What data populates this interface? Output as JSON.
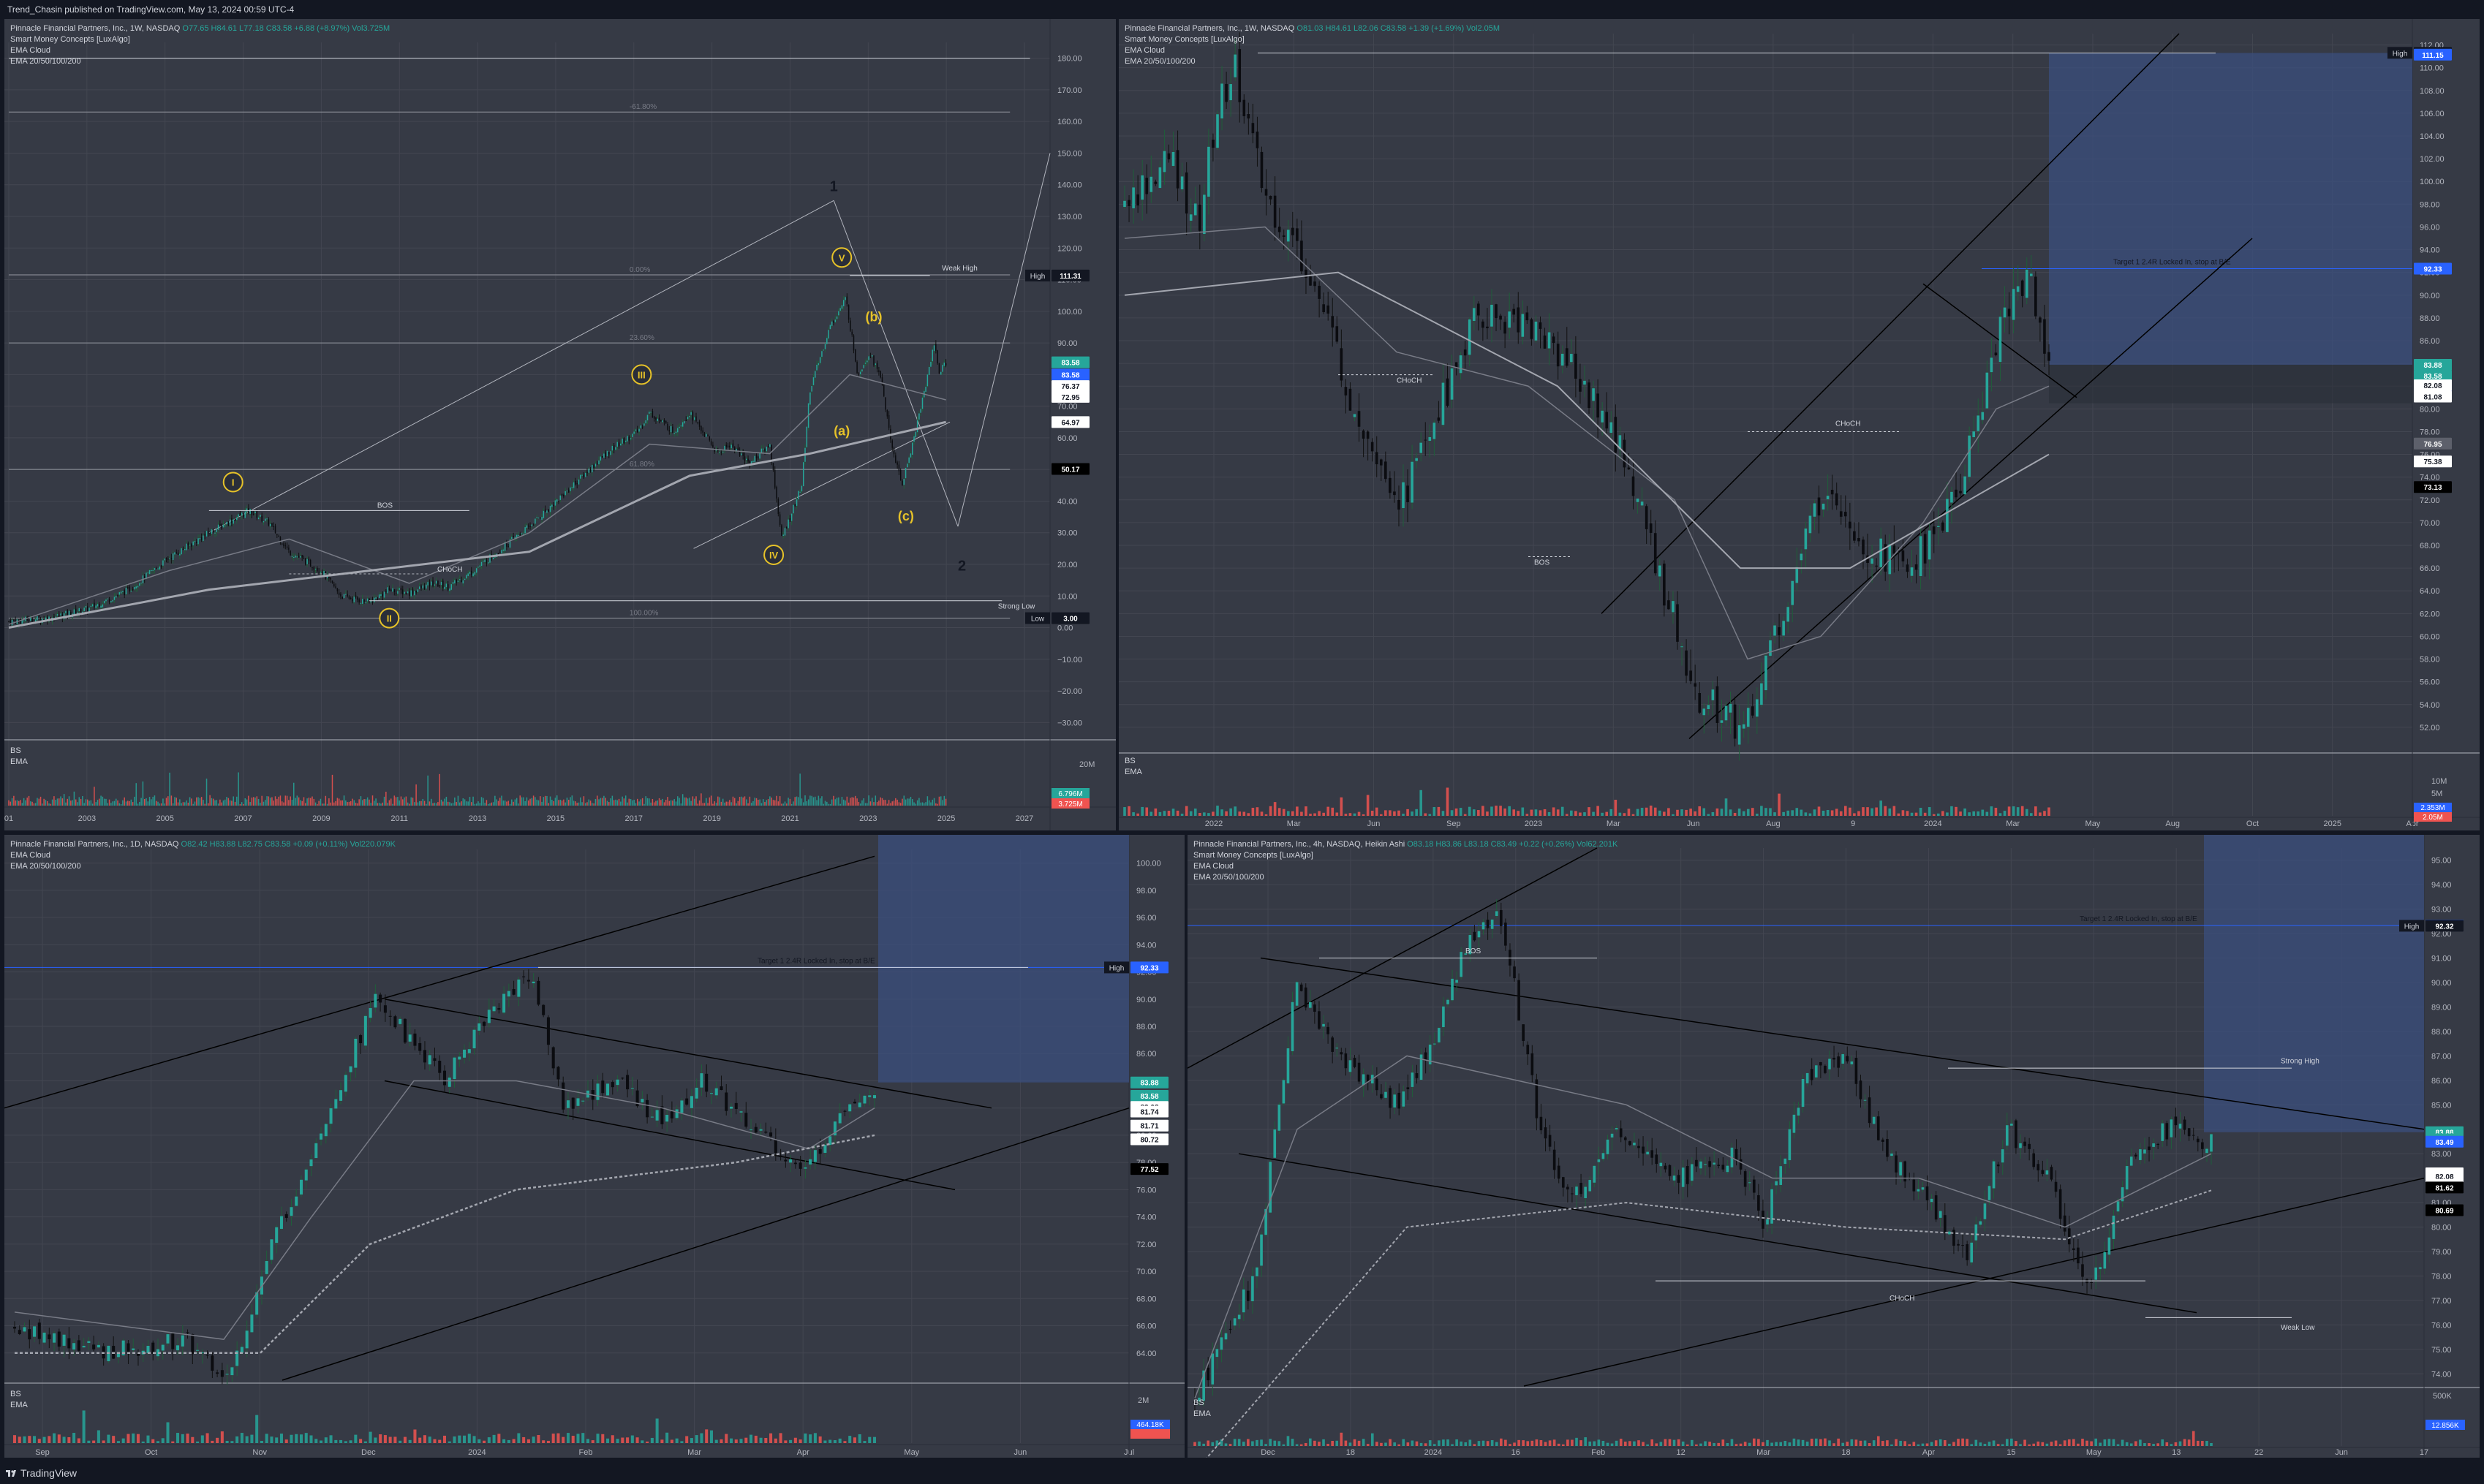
{
  "header": {
    "text": "Trend_Chasin published on TradingView.com, May 13, 2024 00:59 UTC-4"
  },
  "footer": {
    "brand": "TradingView"
  },
  "colors": {
    "up": "#26a69a",
    "down": "#ef5350",
    "bg": "#363a45",
    "grid": "#434651",
    "target_box": "#3b4f7e",
    "wave": "#e6c229"
  },
  "panels": [
    {
      "id": "weekly-1w",
      "legend": {
        "title": "Pinnacle Financial Partners, Inc., 1W, NASDAQ",
        "ohlc": "O77.65 H84.61 L77.18 C83.58 +6.88 (+8.97%) Vol3.725M",
        "indicators": [
          "Smart Money Concepts [LuxAlgo]",
          "EMA Cloud",
          "EMA 20/50/100/200"
        ]
      },
      "volume_legend": [
        "BS",
        "EMA"
      ],
      "volume_labels": [
        "20M",
        "6.796M",
        "3.725M"
      ],
      "chart_data": {
        "type": "candlestick",
        "timeframe": "1W",
        "x_ticks": [
          "01",
          "2003",
          "2005",
          "2007",
          "2009",
          "2011",
          "2013",
          "2015",
          "2017",
          "2019",
          "2021",
          "2023",
          "2025",
          "2027"
        ],
        "y_ticks": [
          180,
          170,
          160,
          150,
          140,
          130,
          120,
          110,
          100,
          90,
          80,
          70,
          60,
          50,
          40,
          30,
          20,
          10,
          0,
          -10,
          -20,
          -30
        ],
        "ylim": [
          -35,
          185
        ],
        "xlim": [
          2001,
          2028
        ],
        "price_path": [
          [
            2001,
            2
          ],
          [
            2002,
            3
          ],
          [
            2003,
            6
          ],
          [
            2004,
            12
          ],
          [
            2005,
            22
          ],
          [
            2006,
            30
          ],
          [
            2007,
            37
          ],
          [
            2007.5,
            33
          ],
          [
            2008,
            24
          ],
          [
            2008.8,
            18
          ],
          [
            2009.3,
            10
          ],
          [
            2010,
            8
          ],
          [
            2010.5,
            12
          ],
          [
            2011,
            11
          ],
          [
            2011.6,
            14
          ],
          [
            2012,
            13
          ],
          [
            2012.5,
            17
          ],
          [
            2013,
            22
          ],
          [
            2014,
            32
          ],
          [
            2015,
            44
          ],
          [
            2015.5,
            50
          ],
          [
            2016,
            56
          ],
          [
            2016.7,
            62
          ],
          [
            2017,
            68
          ],
          [
            2017.6,
            62
          ],
          [
            2018,
            68
          ],
          [
            2018.7,
            55
          ],
          [
            2019,
            58
          ],
          [
            2019.5,
            52
          ],
          [
            2020,
            58
          ],
          [
            2020.3,
            28
          ],
          [
            2020.8,
            45
          ],
          [
            2021,
            75
          ],
          [
            2021.5,
            95
          ],
          [
            2021.9,
            104
          ],
          [
            2022.2,
            80
          ],
          [
            2022.5,
            87
          ],
          [
            2022.8,
            78
          ],
          [
            2023,
            60
          ],
          [
            2023.3,
            45
          ],
          [
            2023.6,
            60
          ],
          [
            2023.9,
            77
          ],
          [
            2024.1,
            90
          ],
          [
            2024.25,
            80
          ],
          [
            2024.37,
            83.58
          ]
        ],
        "price_labels": [
          {
            "value": 111.31,
            "text": "111.31",
            "tag": "High",
            "color": "#131722"
          },
          {
            "value": 83.88,
            "text": "83.58",
            "sub": "18d 16h",
            "color": "#26a69a"
          },
          {
            "value": 80,
            "text": "83.58",
            "color": "#2962ff"
          },
          {
            "value": 76.37,
            "text": "76.37",
            "color": "#ffffff"
          },
          {
            "value": 72.95,
            "text": "72.95",
            "color": "#ffffff"
          },
          {
            "value": 64.97,
            "text": "64.97",
            "color": "#ffffff"
          },
          {
            "value": 50.17,
            "text": "50.17",
            "color": "#000000"
          },
          {
            "value": 3.0,
            "text": "3.00",
            "tag": "Low",
            "color": "#131722"
          }
        ],
        "fib_labels": [
          "-61.80%",
          "0.00%",
          "23.60%",
          "61.80%",
          "100.00%"
        ],
        "annotations": [
          "Weak High",
          "Strong Low",
          "BOS",
          "CHoCH"
        ],
        "wave_labels": [
          "i",
          "ii",
          "iii",
          "iv",
          "v",
          "(a)",
          "(b)",
          "(c)",
          "1",
          "2"
        ]
      }
    },
    {
      "id": "daily-1w-zoom",
      "legend": {
        "title": "Pinnacle Financial Partners, Inc., 1W, NASDAQ",
        "ohlc": "O81.03 H84.61 L82.06 C83.58 +1.39 (+1.69%) Vol2.05M",
        "indicators": [
          "Smart Money Concepts [LuxAlgo]",
          "EMA Cloud",
          "EMA 20/50/100/200"
        ]
      },
      "volume_legend": [
        "BS",
        "EMA"
      ],
      "volume_labels": [
        "10M",
        "5M",
        "2.353M",
        "2.05M"
      ],
      "target_text": "Target 1 2.4R Locked In, stop at B/E",
      "chart_data": {
        "type": "candlestick",
        "x_ticks": [
          "2022",
          "Mar",
          "Jun",
          "Sep",
          "2023",
          "Mar",
          "Jun",
          "Aug",
          "9",
          "2024",
          "Mar",
          "May",
          "Aug",
          "Oct",
          "2025",
          "Apr"
        ],
        "y_ticks": [
          112,
          110,
          108,
          106,
          104,
          102,
          100,
          98,
          96,
          94,
          92,
          90,
          88,
          86,
          84,
          82,
          80,
          78,
          76,
          74,
          72,
          70,
          68,
          66,
          64,
          62,
          60,
          58,
          56,
          54,
          52
        ],
        "ylim": [
          50,
          113
        ],
        "price_labels": [
          {
            "value": 111.31,
            "text": "111.31",
            "tag": "High",
            "color": "#131722"
          },
          {
            "value": 111.15,
            "text": "111.15",
            "color": "#2962ff"
          },
          {
            "value": 92.33,
            "text": "92.33",
            "color": "#2962ff"
          },
          {
            "value": 83.88,
            "text": "83.88",
            "color": "#26a69a"
          },
          {
            "value": 82.9,
            "text": "83.58",
            "color": "#26a69a"
          },
          {
            "value": 81.9,
            "text": "83.58",
            "color": "#2962ff"
          },
          {
            "value": 82.08,
            "text": "82.08",
            "color": "#ffffff"
          },
          {
            "value": 81.08,
            "text": "81.08",
            "color": "#ffffff"
          },
          {
            "value": 76.95,
            "text": "76.95",
            "color": "#5d606b"
          },
          {
            "value": 75.38,
            "text": "75.38",
            "color": "#ffffff"
          },
          {
            "value": 73.13,
            "text": "73.13",
            "color": "#000000"
          }
        ]
      }
    },
    {
      "id": "daily-1d",
      "legend": {
        "title": "Pinnacle Financial Partners, Inc., 1D, NASDAQ",
        "ohlc": "O82.42 H83.88 L82.75 C83.58 +0.09 (+0.11%) Vol220.079K",
        "indicators": [
          "EMA Cloud",
          "EMA 20/50/100/200"
        ]
      },
      "volume_legend": [
        "BS",
        "EMA"
      ],
      "volume_labels": [
        "2M",
        "464.18K"
      ],
      "target_text": "Target 1 2.4R Locked In, stop at B/E",
      "chart_data": {
        "type": "candlestick",
        "x_ticks": [
          "Sep",
          "Oct",
          "Nov",
          "Dec",
          "2024",
          "Feb",
          "Mar",
          "Apr",
          "May",
          "Jun",
          "Jul"
        ],
        "y_ticks": [
          100,
          98,
          96,
          94,
          92,
          90,
          88,
          86,
          84,
          82,
          80,
          78,
          76,
          74,
          72,
          70,
          68,
          66,
          64
        ],
        "ylim": [
          62,
          101
        ],
        "price_labels": [
          {
            "value": 92.33,
            "text": "92.33",
            "tag": "High",
            "color": "#2962ff"
          },
          {
            "value": 83.88,
            "text": "83.88",
            "color": "#26a69a"
          },
          {
            "value": 82.9,
            "text": "83.58",
            "color": "#26a69a"
          },
          {
            "value": 82.08,
            "text": "82.08",
            "color": "#ffffff"
          },
          {
            "value": 81.74,
            "text": "81.74",
            "color": "#ffffff"
          },
          {
            "value": 80.71,
            "text": "81.71",
            "color": "#ffffff"
          },
          {
            "value": 79.7,
            "text": "80.72",
            "color": "#ffffff"
          },
          {
            "value": 77.52,
            "text": "77.52",
            "color": "#000000"
          }
        ]
      }
    },
    {
      "id": "intraday-4h",
      "legend": {
        "title": "Pinnacle Financial Partners, Inc., 4h, NASDAQ, Heikin Ashi",
        "ohlc": "O83.18 H83.86 L83.18 C83.49 +0.22 (+0.26%) Vol62.201K",
        "indicators": [
          "Smart Money Concepts [LuxAlgo]",
          "EMA Cloud",
          "EMA 20/50/100/200"
        ]
      },
      "volume_legend": [
        "BS",
        "EMA"
      ],
      "volume_labels": [
        "500K",
        "12.856K"
      ],
      "target_text": "Target 1 2.4R Locked In, stop at B/E",
      "chart_data": {
        "type": "candlestick",
        "x_ticks": [
          "Dec",
          "18",
          "2024",
          "16",
          "Feb",
          "12",
          "Mar",
          "18",
          "Apr",
          "15",
          "May",
          "13",
          "22",
          "Jun",
          "17"
        ],
        "y_ticks": [
          95,
          94,
          93,
          92,
          91,
          90,
          89,
          88,
          87,
          86,
          85,
          84,
          83,
          82,
          81,
          80,
          79,
          78,
          77,
          76,
          75,
          74
        ],
        "ylim": [
          73.5,
          95.5
        ],
        "price_labels": [
          {
            "value": 92.33,
            "text": "92.33",
            "color": "#2962ff"
          },
          {
            "value": 92.32,
            "text": "92.32",
            "tag": "High",
            "color": "#131722"
          },
          {
            "value": 83.88,
            "text": "83.88",
            "color": "#26a69a"
          },
          {
            "value": 83.59,
            "text": "83.59",
            "color": "#26a69a"
          },
          {
            "value": 83.49,
            "text": "83.49",
            "color": "#2962ff"
          },
          {
            "value": 82.2,
            "text": "82.20",
            "color": "#ffffff"
          },
          {
            "value": 82.08,
            "text": "82.08",
            "color": "#ffffff"
          },
          {
            "value": 81.73,
            "text": "81.73",
            "color": "#ffffff"
          },
          {
            "value": 81.62,
            "text": "81.62",
            "color": "#000000"
          },
          {
            "value": 80.69,
            "text": "80.69",
            "color": "#000000"
          }
        ]
      }
    }
  ]
}
